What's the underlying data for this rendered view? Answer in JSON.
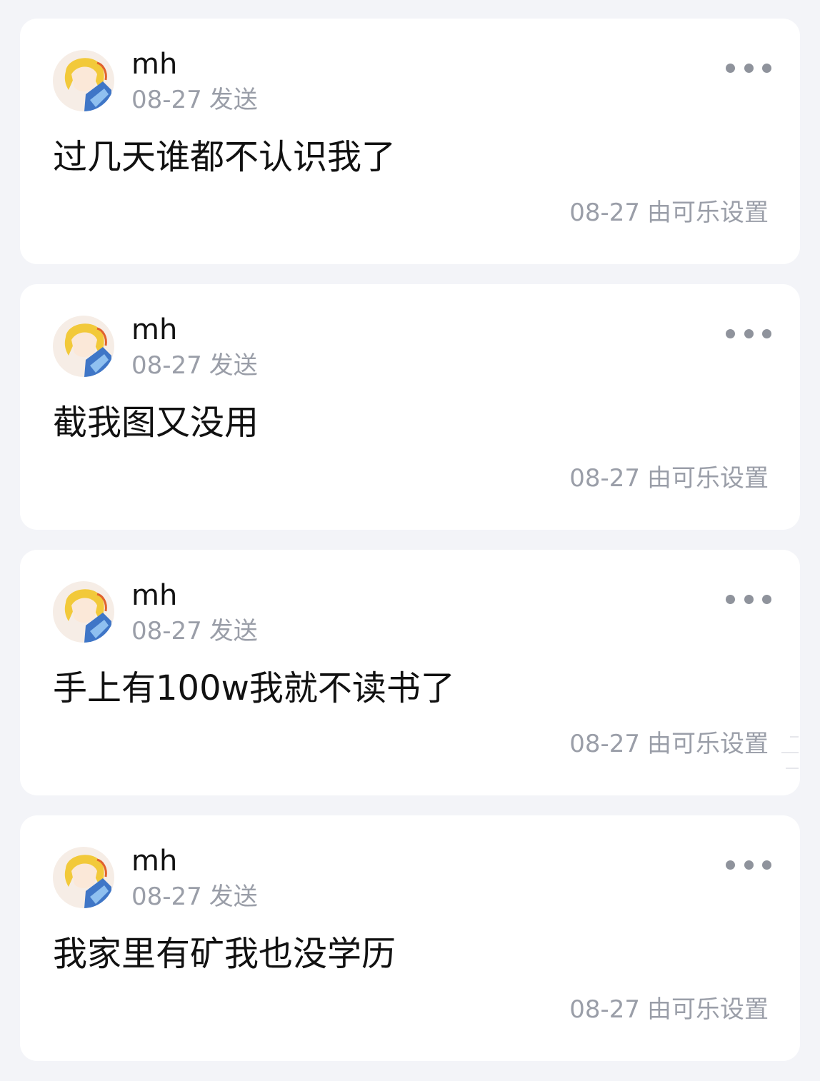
{
  "posts": [
    {
      "username": "mh",
      "sent_date": "08-27",
      "sent_label": "发送",
      "message": "过几天谁都不认识我了",
      "set_date": "08-27",
      "set_label": "由可乐设置",
      "avatar_icon": "anime-avatar",
      "more_icon": "more-icon"
    },
    {
      "username": "mh",
      "sent_date": "08-27",
      "sent_label": "发送",
      "message": "截我图又没用",
      "set_date": "08-27",
      "set_label": "由可乐设置",
      "avatar_icon": "anime-avatar",
      "more_icon": "more-icon"
    },
    {
      "username": "mh",
      "sent_date": "08-27",
      "sent_label": "发送",
      "message": "手上有100w我就不读书了",
      "set_date": "08-27",
      "set_label": "由可乐设置",
      "avatar_icon": "anime-avatar",
      "more_icon": "more-icon"
    },
    {
      "username": "mh",
      "sent_date": "08-27",
      "sent_label": "发送",
      "message": "我家里有矿我也没学历",
      "set_date": "08-27",
      "set_label": "由可乐设置",
      "avatar_icon": "anime-avatar",
      "more_icon": "more-icon"
    }
  ],
  "colors": {
    "background": "#f3f4f8",
    "card": "#ffffff",
    "primary_text": "#111111",
    "secondary_text": "#9a9ea8",
    "more_dots": "#8f939c"
  }
}
